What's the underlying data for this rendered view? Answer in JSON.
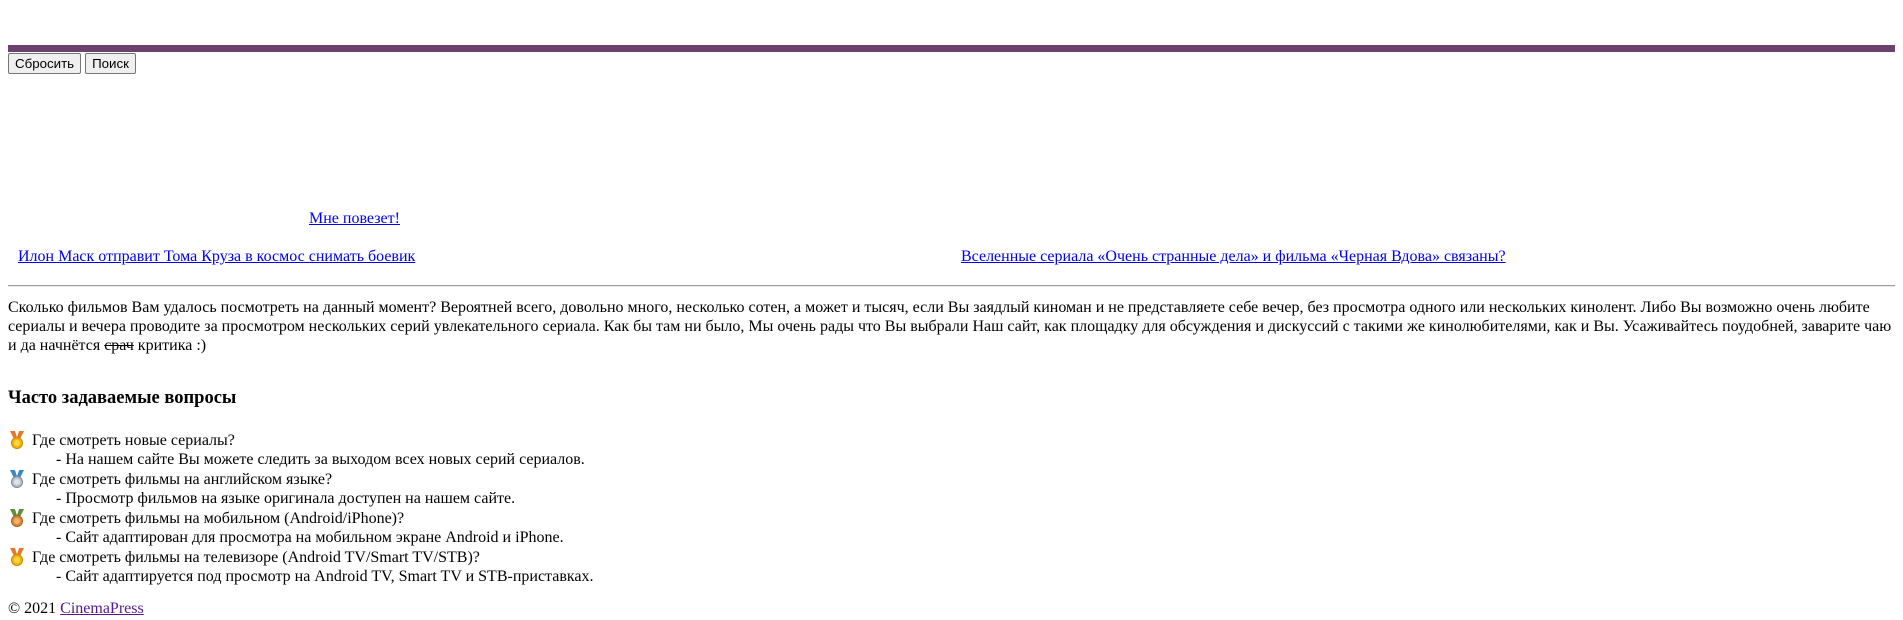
{
  "toolbar": {
    "reset_label": "Сбросить",
    "search_label": "Поиск"
  },
  "lucky_link": " Мне повезет!",
  "news": {
    "left": "Илон Маск отправит Тома Круза в космос снимать боевик",
    "right": "Вселенные сериала «Очень странные дела» и фильма «Черная Вдова» связаны?"
  },
  "intro": {
    "text_main": "Сколько фильмов Вам удалось посмотреть на данный момент? Вероятней всего, довольно много, несколько сотен, а может и тысяч, если Вы заядлый киноман и не представляете себе вечер, без просмотра одного или нескольких кинолент. Либо Вы возможно очень любите сериалы и вечера проводите за просмотром нескольких серий увлекательного сериала. Как бы там ни было, Мы очень рады что Вы выбрали Наш сайт, как площадку для обсуждения и дискуссий с такими же кинолюбителями, как и Вы. Усаживайтесь поудобней, заварите чаю и да начнётся ",
    "struck": "срач",
    "text_end": " критика :)"
  },
  "faq": {
    "title": "Часто задаваемые вопросы",
    "items": [
      {
        "question": "Где смотреть новые сериалы?",
        "answer": "- На нашем сайте Вы можете следить за выходом всех новых серий сериалов.",
        "medal": "gold-medal-icon",
        "ribbon": "#e8772e"
      },
      {
        "question": "Где смотреть фильмы на английском языке?",
        "answer": "- Просмотр фильмов на языке оригинала доступен на нашем сайте.",
        "medal": "silver-medal-icon",
        "ribbon": "#3b88c3"
      },
      {
        "question": "Где смотреть фильмы на мобильном (Android/iPhone)?",
        "answer": "- Сайт адаптирован для просмотра на мобильном экране Android и iPhone.",
        "medal": "bronze-medal-icon",
        "ribbon": "#5c913b"
      },
      {
        "question": "Где смотреть фильмы на телевизоре (Android TV/Smart TV/STB)?",
        "answer": "- Сайт адаптируется под просмотр на Android TV, Smart TV и STB-приставках.",
        "medal": "gold-medal-icon",
        "ribbon": "#e8772e"
      }
    ]
  },
  "footer": {
    "copyright": "© 2021 ",
    "link": "CinemaPress"
  },
  "colors": {
    "bar": "#6b4170",
    "link": "#0000ee",
    "visited": "#551a8b"
  }
}
